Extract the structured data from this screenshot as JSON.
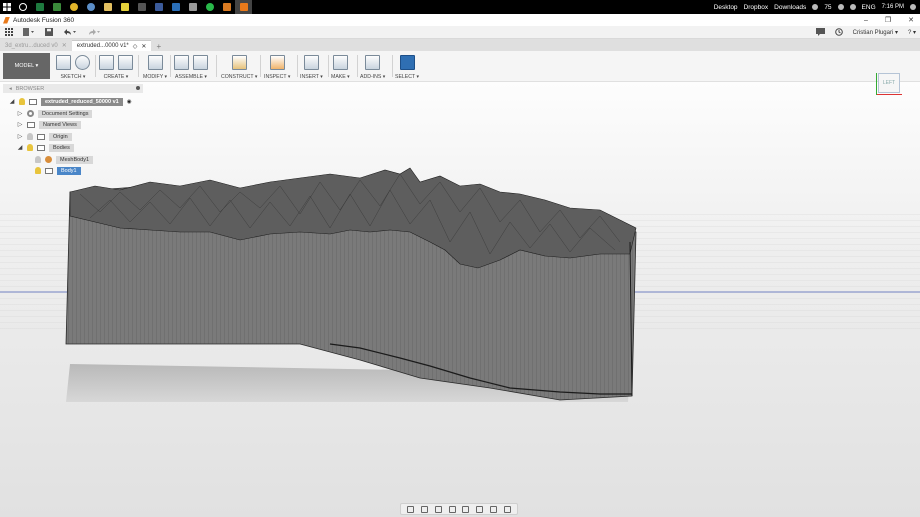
{
  "taskbar": {
    "right_items": [
      "Desktop",
      "Dropbox",
      "Downloads"
    ],
    "battery_percent": "75",
    "language": "ENG",
    "time": "7:16 PM"
  },
  "window": {
    "title": "Autodesk Fusion 360",
    "controls": [
      "–",
      "❐",
      "✕"
    ]
  },
  "quick_access": {
    "user_name": "Cristian Plugari ▾",
    "help_label": "? ▾"
  },
  "tabs": [
    {
      "label": "3d_extru...duced v0"
    },
    {
      "label": "extruded...0000 v1*"
    }
  ],
  "ribbon": {
    "workspace": "MODEL ▾",
    "groups": [
      "SKETCH ▾",
      "CREATE ▾",
      "MODIFY ▾",
      "ASSEMBLE ▾",
      "CONSTRUCT ▾",
      "INSPECT ▾",
      "INSERT ▾",
      "MAKE ▾",
      "ADD-INS ▾",
      "SELECT ▾"
    ]
  },
  "browser": {
    "title": "BROWSER",
    "root": "extruded_reduced_50000 v1",
    "items": [
      "Document Settings",
      "Named Views",
      "Origin",
      "Bodies",
      "MeshBody1",
      "Body1"
    ]
  },
  "viewcube": {
    "face": "LEFT"
  },
  "colors": {
    "accent": "#2f6fb3",
    "selection": "#4a86c8",
    "orange": "#e97a1b"
  }
}
